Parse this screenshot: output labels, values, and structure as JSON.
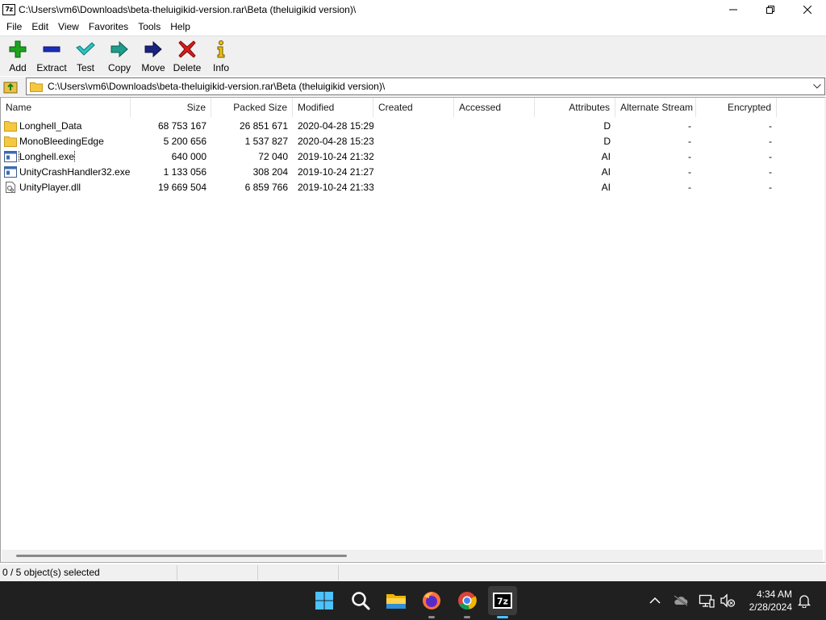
{
  "window": {
    "app_icon_text": "7z",
    "title": "C:\\Users\\vm6\\Downloads\\beta-theluigikid-version.rar\\Beta (theluigikid version)\\"
  },
  "menu": [
    "File",
    "Edit",
    "View",
    "Favorites",
    "Tools",
    "Help"
  ],
  "toolbar": {
    "add": "Add",
    "extract": "Extract",
    "test": "Test",
    "copy": "Copy",
    "move": "Move",
    "delete": "Delete",
    "info": "Info"
  },
  "address": {
    "path": "C:\\Users\\vm6\\Downloads\\beta-theluigikid-version.rar\\Beta (theluigikid version)\\"
  },
  "columns": {
    "name": "Name",
    "size": "Size",
    "packed": "Packed Size",
    "modified": "Modified",
    "created": "Created",
    "accessed": "Accessed",
    "attributes": "Attributes",
    "alt_stream": "Alternate Stream",
    "encrypted": "Encrypted"
  },
  "files": [
    {
      "icon": "folder-icon",
      "name": "Longhell_Data",
      "size": "68 753 167",
      "packed": "26 851 671",
      "modified": "2020-04-28 15:29",
      "created": "",
      "accessed": "",
      "attributes": "D",
      "alt_stream": "-",
      "encrypted": "-"
    },
    {
      "icon": "folder-icon",
      "name": "MonoBleedingEdge",
      "size": "5 200 656",
      "packed": "1 537 827",
      "modified": "2020-04-28 15:23",
      "created": "",
      "accessed": "",
      "attributes": "D",
      "alt_stream": "-",
      "encrypted": "-"
    },
    {
      "icon": "exe-icon",
      "name": "Longhell.exe",
      "size": "640 000",
      "packed": "72 040",
      "modified": "2019-10-24 21:32",
      "created": "",
      "accessed": "",
      "attributes": "AI",
      "alt_stream": "-",
      "encrypted": "-"
    },
    {
      "icon": "exe-icon",
      "name": "UnityCrashHandler32.exe",
      "size": "1 133 056",
      "packed": "308 204",
      "modified": "2019-10-24 21:27",
      "created": "",
      "accessed": "",
      "attributes": "AI",
      "alt_stream": "-",
      "encrypted": "-"
    },
    {
      "icon": "dll-icon",
      "name": "UnityPlayer.dll",
      "size": "19 669 504",
      "packed": "6 859 766",
      "modified": "2019-10-24 21:33",
      "created": "",
      "accessed": "",
      "attributes": "AI",
      "alt_stream": "-",
      "encrypted": "-"
    }
  ],
  "status": {
    "selection": "0 / 5 object(s) selected"
  },
  "taskbar": {
    "apps": [
      "start-icon",
      "search-icon",
      "file-explorer-icon",
      "firefox-icon",
      "chrome-icon",
      "7zip-icon"
    ],
    "clock_time": "4:34 AM",
    "clock_date": "2/28/2024"
  }
}
